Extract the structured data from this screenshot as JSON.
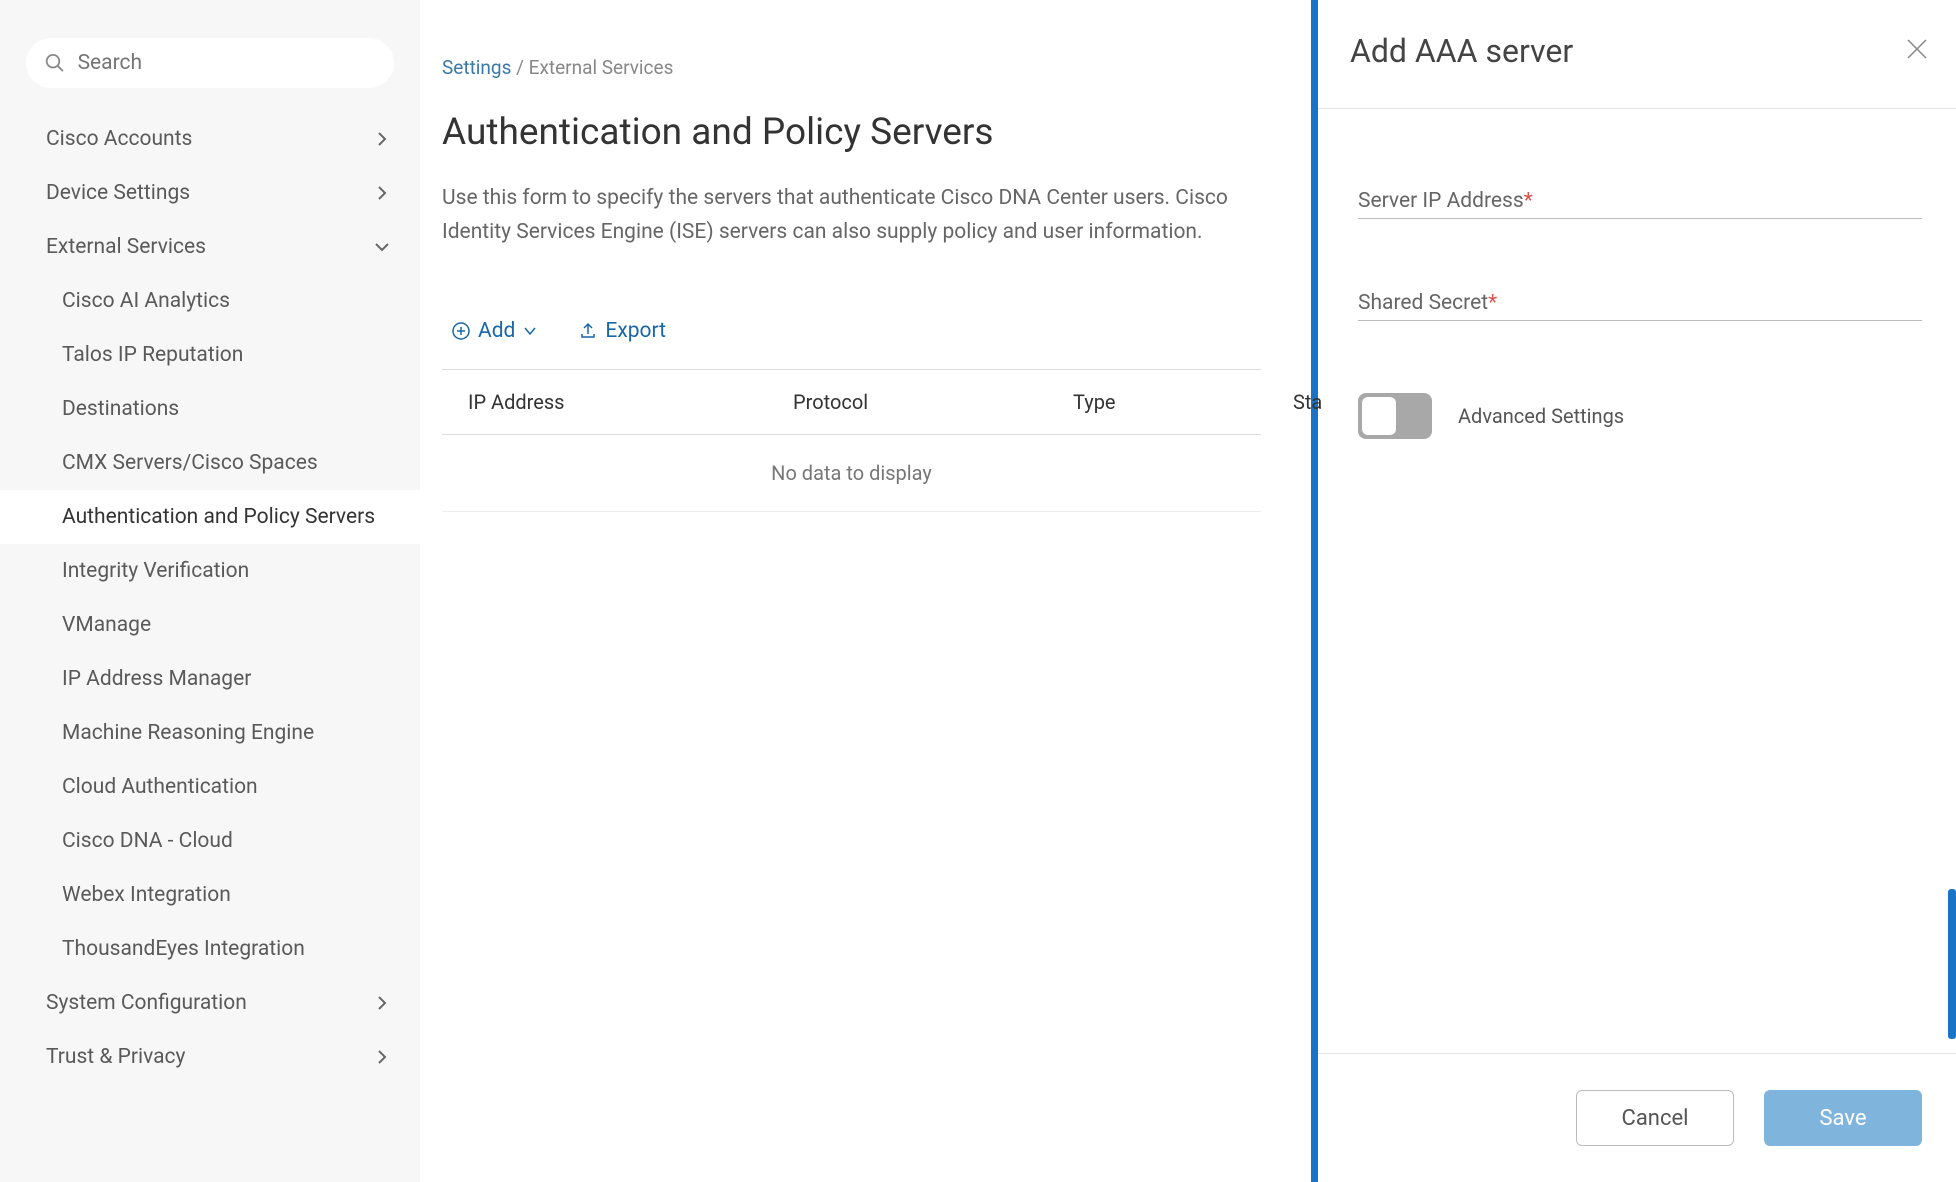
{
  "search": {
    "placeholder": "Search"
  },
  "sidebar": {
    "cisco_accounts": "Cisco Accounts",
    "device_settings": "Device Settings",
    "external_services": "External Services",
    "children": {
      "ai_analytics": "Cisco AI Analytics",
      "talos": "Talos IP Reputation",
      "destinations": "Destinations",
      "cmx": "CMX Servers/Cisco Spaces",
      "auth_policy": "Authentication and Policy Servers",
      "integrity": "Integrity Verification",
      "vmanage": "VManage",
      "ip_addr": "IP Address Manager",
      "mre": "Machine Reasoning Engine",
      "cloud_auth": "Cloud Authentication",
      "dna_cloud": "Cisco DNA - Cloud",
      "webex": "Webex Integration",
      "thousand": "ThousandEyes Integration"
    },
    "system_config": "System Configuration",
    "trust_privacy": "Trust & Privacy"
  },
  "breadcrumb": {
    "root": "Settings",
    "sep": " / ",
    "current": "External Services"
  },
  "page": {
    "title": "Authentication and Policy Servers",
    "desc": "Use this form to specify the servers that authenticate Cisco DNA Center users. Cisco Identity Services Engine (ISE) servers can also supply policy and user information."
  },
  "actions": {
    "add": "Add",
    "export": "Export"
  },
  "table": {
    "headers": {
      "ip": "IP Address",
      "protocol": "Protocol",
      "type": "Type",
      "status": "Sta"
    },
    "empty": "No data to display"
  },
  "panel": {
    "title": "Add AAA server",
    "server_ip": "Server IP Address",
    "shared_secret": "Shared Secret",
    "required_mark": "*",
    "adv": "Advanced Settings",
    "cancel": "Cancel",
    "save": "Save"
  }
}
